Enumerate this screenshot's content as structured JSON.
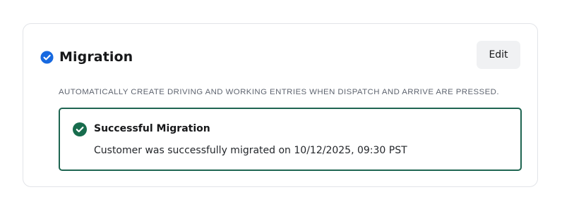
{
  "section": {
    "title": "Migration",
    "title_icon": "check-circle-icon",
    "edit_label": "Edit",
    "description": "AUTOMATICALLY CREATE DRIVING AND WORKING ENTRIES WHEN DISPATCH AND ARRIVE ARE PRESSED."
  },
  "alert": {
    "icon": "check-circle-icon",
    "title": "Successful Migration",
    "message": "Customer was successfully migrated on 10/12/2025, 09:30 PST"
  },
  "colors": {
    "title_icon": "#1769e0",
    "success": "#176c4d",
    "alert_border": "#1e6551",
    "edit_button_bg": "#f0f1f3",
    "card_border": "#e2e4e8"
  }
}
